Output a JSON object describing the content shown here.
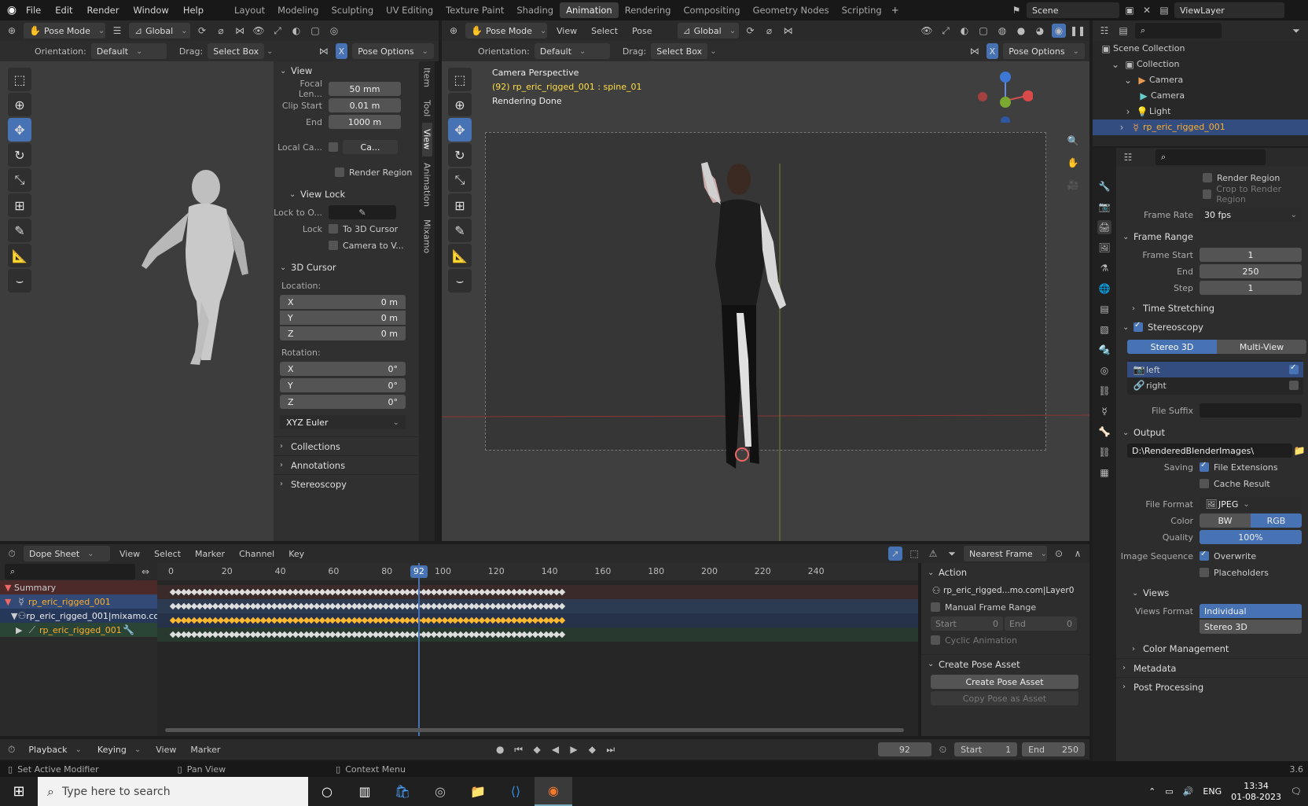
{
  "top_menu": {
    "file": "File",
    "edit": "Edit",
    "render": "Render",
    "window": "Window",
    "help": "Help"
  },
  "workspaces": [
    "Layout",
    "Modeling",
    "Sculpting",
    "UV Editing",
    "Texture Paint",
    "Shading",
    "Animation",
    "Rendering",
    "Compositing",
    "Geometry Nodes",
    "Scripting"
  ],
  "active_workspace": "Animation",
  "scene": "Scene",
  "view_layer": "ViewLayer",
  "left_viewport": {
    "mode": "Pose Mode",
    "transform": "Global",
    "orientation_label": "Orientation:",
    "orientation": "Default",
    "drag_label": "Drag:",
    "drag": "Select Box",
    "pose_options": "Pose Options"
  },
  "npanel": {
    "tabs": [
      "Item",
      "Tool",
      "View",
      "Animation",
      "Mixamo"
    ],
    "view_header": "View",
    "focal_label": "Focal Len...",
    "focal": "50 mm",
    "clip_start_label": "Clip Start",
    "clip_start": "0.01 m",
    "end_label": "End",
    "clip_end": "1000 m",
    "local_cam_label": "Local Ca...",
    "local_cam_value": "Ca...",
    "render_region": "Render Region",
    "view_lock": "View Lock",
    "lock_to_label": "Lock to O...",
    "lock_label": "Lock",
    "to_3d_cursor": "To 3D Cursor",
    "camera_to_view": "Camera to V...",
    "cursor_header": "3D Cursor",
    "location_label": "Location:",
    "loc_x": "0 m",
    "loc_y": "0 m",
    "loc_z": "0 m",
    "rotation_label": "Rotation:",
    "rot_x": "0°",
    "rot_y": "0°",
    "rot_z": "0°",
    "rotation_mode": "XYZ Euler",
    "collections": "Collections",
    "annotations": "Annotations",
    "stereoscopy": "Stereoscopy",
    "axis_x": "X",
    "axis_y": "Y",
    "axis_z": "Z"
  },
  "right_viewport": {
    "mode": "Pose Mode",
    "view": "View",
    "select": "Select",
    "pose": "Pose",
    "transform": "Global",
    "orientation_label": "Orientation:",
    "orientation": "Default",
    "drag_label": "Drag:",
    "drag": "Select Box",
    "pose_options": "Pose Options",
    "overlay_title": "Camera Perspective",
    "overlay_object": "(92) rp_eric_rigged_001 : spine_01",
    "overlay_status": "Rendering Done"
  },
  "outliner": {
    "scene_collection": "Scene Collection",
    "items": [
      {
        "label": "Collection",
        "level": 1
      },
      {
        "label": "Camera",
        "level": 2
      },
      {
        "label": "Camera",
        "level": 3
      },
      {
        "label": "Light",
        "level": 2
      },
      {
        "label": "rp_eric_rigged_001",
        "level": 2
      }
    ]
  },
  "properties": {
    "render_region": "Render Region",
    "crop_region": "Crop to Render Region",
    "frame_rate_label": "Frame Rate",
    "frame_rate": "30 fps",
    "frame_range": "Frame Range",
    "frame_start_label": "Frame Start",
    "frame_start": "1",
    "end_label": "End",
    "frame_end": "250",
    "step_label": "Step",
    "step": "1",
    "time_stretching": "Time Stretching",
    "stereoscopy": "Stereoscopy",
    "stereo_3d": "Stereo 3D",
    "multi_view": "Multi-View",
    "left": "left",
    "right": "right",
    "file_suffix": "File Suffix",
    "output": "Output",
    "output_path": "D:\\RenderedBlenderImages\\",
    "saving_label": "Saving",
    "file_extensions": "File Extensions",
    "cache_result": "Cache Result",
    "file_format_label": "File Format",
    "file_format": "JPEG",
    "color_label": "Color",
    "bw": "BW",
    "rgb": "RGB",
    "quality_label": "Quality",
    "quality": "100%",
    "quality_fraction": 1.0,
    "image_sequence_label": "Image Sequence",
    "overwrite": "Overwrite",
    "placeholders": "Placeholders",
    "views": "Views",
    "views_format_label": "Views Format",
    "individual": "Individual",
    "stereo_3d_2": "Stereo 3D",
    "color_management": "Color Management",
    "metadata": "Metadata",
    "post_processing": "Post Processing",
    "version": "3.6"
  },
  "dopesheet": {
    "editor": "Dope Sheet",
    "menu": [
      "View",
      "Select",
      "Marker",
      "Channel",
      "Key"
    ],
    "snap": "Nearest Frame",
    "channels": [
      {
        "label": "Summary"
      },
      {
        "label": "rp_eric_rigged_001"
      },
      {
        "label": "rp_eric_rigged_001|mixamo.co"
      },
      {
        "label": "rp_eric_rigged_001"
      }
    ],
    "ruler": [
      "0",
      "20",
      "40",
      "60",
      "80",
      "100",
      "120",
      "140",
      "160",
      "180",
      "200",
      "220",
      "240"
    ],
    "current_frame": "92",
    "action_header": "Action",
    "action_name": "rp_eric_rigged...mo.com|Layer0",
    "manual_frame_range": "Manual Frame Range",
    "start_label": "Start",
    "start": "0",
    "end_label": "End",
    "end": "0",
    "cyclic": "Cyclic Animation",
    "create_pose_header": "Create Pose Asset",
    "create_pose_btn": "Create Pose Asset",
    "copy_pose_btn": "Copy Pose as Asset"
  },
  "timeline": {
    "menu": [
      "Playback",
      "Keying",
      "View",
      "Marker"
    ],
    "current": "92",
    "start_label": "Start",
    "start": "1",
    "end_label": "End",
    "end": "250"
  },
  "status": {
    "set_active_modifier": "Set Active Modifier",
    "pan_view": "Pan View",
    "context_menu": "Context Menu"
  },
  "taskbar": {
    "search_placeholder": "Type here to search",
    "lang": "ENG",
    "time": "13:34",
    "date": "01-08-2023"
  }
}
